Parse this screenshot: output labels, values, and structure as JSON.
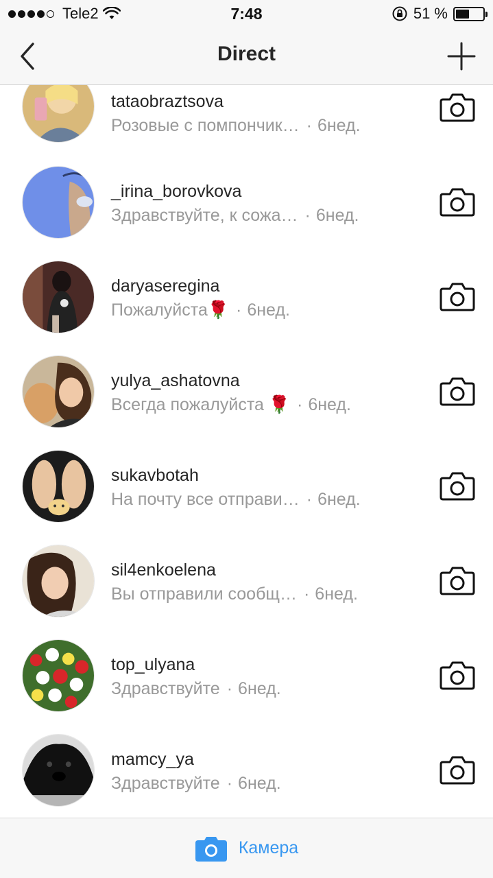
{
  "status_bar": {
    "carrier": "Tele2",
    "time": "7:48",
    "battery_percent": "51 %",
    "battery_level": 0.51
  },
  "header": {
    "title": "Direct",
    "back_icon": "chevron-left-icon",
    "add_icon": "plus-icon"
  },
  "threads": [
    {
      "username": "tataobraztsova",
      "preview": "Розовые с помпончик…",
      "time": "6нед."
    },
    {
      "username": "_irina_borovkova",
      "preview": "Здравствуйте, к сожа…",
      "time": "6нед."
    },
    {
      "username": "daryaseregina",
      "preview": "Пожалуйста🌹",
      "time": "6нед."
    },
    {
      "username": "yulya_ashatovna",
      "preview": "Всегда пожалуйста 🌹",
      "time": "6нед."
    },
    {
      "username": "sukavbotah",
      "preview": "На почту все отправи…",
      "time": "6нед."
    },
    {
      "username": "sil4enkoelena",
      "preview": "Вы отправили сообщ…",
      "time": "6нед."
    },
    {
      "username": "top_ulyana",
      "preview": "Здравствуйте",
      "time": "6нед."
    },
    {
      "username": "mamcy_ya",
      "preview": "Здравствуйте",
      "time": "6нед."
    }
  ],
  "footer": {
    "camera_label": "Камера",
    "camera_icon": "camera-icon"
  },
  "colors": {
    "accent": "#3897f0",
    "secondary_text": "#999999",
    "primary_text": "#262626",
    "bar_background": "#f7f7f7"
  }
}
